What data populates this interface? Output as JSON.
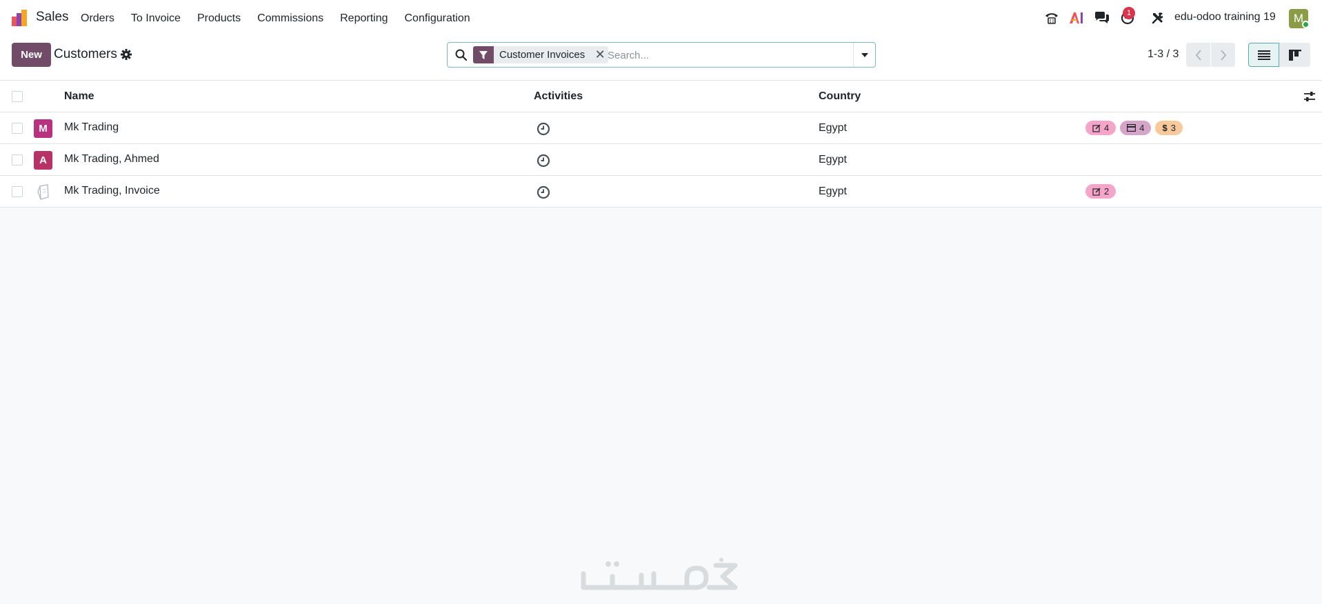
{
  "app": {
    "name": "Sales",
    "menu": [
      "Orders",
      "To Invoice",
      "Products",
      "Commissions",
      "Reporting",
      "Configuration"
    ],
    "activity_count": "1",
    "company": "edu-odoo training 19",
    "user_initial": "M"
  },
  "control": {
    "new_label": "New",
    "title": "Customers",
    "facet_label": "Customer Invoices",
    "search_placeholder": "Search...",
    "pager": "1-3 / 3"
  },
  "columns": {
    "name": "Name",
    "activities": "Activities",
    "country": "Country"
  },
  "rows": [
    {
      "initial": "M",
      "avatar_color": "#b83280",
      "name": "Mk Trading",
      "country": "Egypt",
      "stats": [
        {
          "icon": "edit-icon",
          "value": "4",
          "color": "#f4a5c9"
        },
        {
          "icon": "card-icon",
          "value": "4",
          "color": "#d4a5c8"
        },
        {
          "icon": "dollar-icon",
          "value": "3",
          "color": "#f8c99a"
        }
      ]
    },
    {
      "initial": "A",
      "avatar_color": "#b83268",
      "name": "Mk Trading, Ahmed",
      "country": "Egypt",
      "stats": []
    },
    {
      "initial": "",
      "avatar_color": "",
      "name": "Mk Trading, Invoice",
      "country": "Egypt",
      "stats": [
        {
          "icon": "edit-icon",
          "value": "2",
          "color": "#f4a5c9"
        }
      ]
    }
  ],
  "colors": {
    "primary": "#714b67",
    "accent": "#017e84",
    "badge": "#d9344b"
  }
}
